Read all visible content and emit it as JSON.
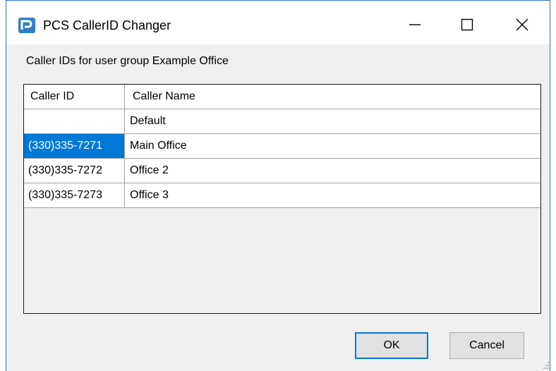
{
  "window": {
    "title": "PCS CallerID Changer",
    "minimize_glyph": "—",
    "maximize_glyph": "☐",
    "close_glyph": "✕"
  },
  "group_label": "Caller IDs for user group Example Office",
  "grid": {
    "headers": [
      "Caller ID",
      "Caller Name"
    ],
    "rows": [
      {
        "caller_id": "",
        "caller_name": "Default"
      },
      {
        "caller_id": "(330)335-7271",
        "caller_name": "Main Office",
        "selected": true
      },
      {
        "caller_id": "(330)335-7272",
        "caller_name": "Office 2"
      },
      {
        "caller_id": "(330)335-7273",
        "caller_name": "Office 3"
      }
    ]
  },
  "buttons": {
    "ok": "OK",
    "cancel": "Cancel"
  },
  "colors": {
    "accent": "#0078d7",
    "window_border": "#2b74c8",
    "dialog_bg": "#f0f0f0"
  },
  "icons": {
    "app": "pcs-logo-icon",
    "minimize": "minimize-icon",
    "maximize": "maximize-icon",
    "close": "close-icon",
    "grip": "resize-grip-icon"
  }
}
